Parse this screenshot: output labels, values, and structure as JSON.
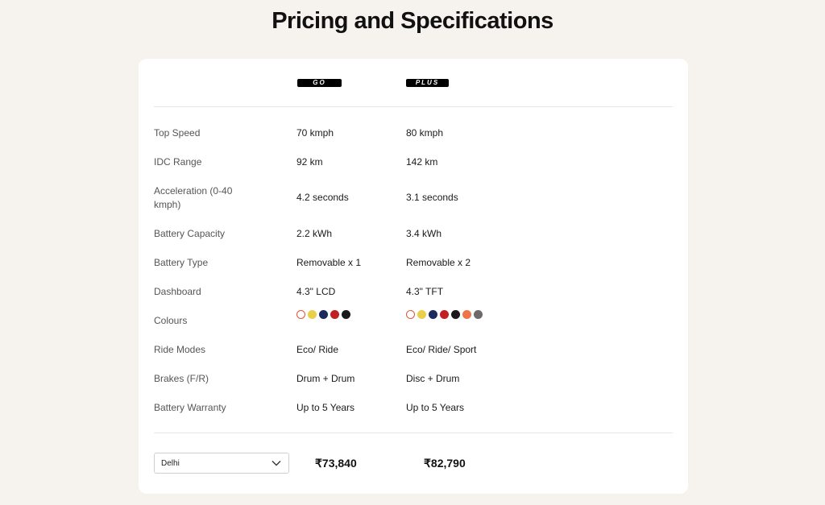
{
  "page": {
    "title": "Pricing and Specifications"
  },
  "variants": [
    {
      "badge": "GO"
    },
    {
      "badge": "PLUS"
    }
  ],
  "specs": [
    {
      "label": "Top Speed",
      "go": "70 kmph",
      "plus": "80 kmph"
    },
    {
      "label": "IDC Range",
      "go": "92 km",
      "plus": "142 km"
    },
    {
      "label": "Acceleration (0-40 kmph)",
      "go": "4.2 seconds",
      "plus": "3.1 seconds"
    },
    {
      "label": "Battery Capacity",
      "go": "2.2 kWh",
      "plus": "3.4 kWh"
    },
    {
      "label": "Battery Type",
      "go": "Removable x 1",
      "plus": "Removable x 2"
    },
    {
      "label": "Dashboard",
      "go": "4.3\" LCD",
      "plus": "4.3\" TFT"
    },
    {
      "label": "Colours"
    },
    {
      "label": "Ride Modes",
      "go": "Eco/ Ride",
      "plus": "Eco/ Ride/ Sport"
    },
    {
      "label": "Brakes (F/R)",
      "go": "Drum + Drum",
      "plus": "Disc + Drum"
    },
    {
      "label": "Battery Warranty",
      "go": "Up to 5 Years",
      "plus": "Up to 5 Years"
    }
  ],
  "colours": {
    "go": [
      "#ffffff",
      "#e9cf4a",
      "#1c2a5c",
      "#c01f25",
      "#1a1a1a"
    ],
    "plus": [
      "#ffffff",
      "#e9cf4a",
      "#1c2a5c",
      "#c01f25",
      "#1a1a1a",
      "#ee7446",
      "#6f6a6a"
    ],
    "outline": "#e0533a"
  },
  "pricing": {
    "city_select": {
      "value": "Delhi"
    },
    "go_price": "₹73,840",
    "plus_price": "₹82,790"
  }
}
